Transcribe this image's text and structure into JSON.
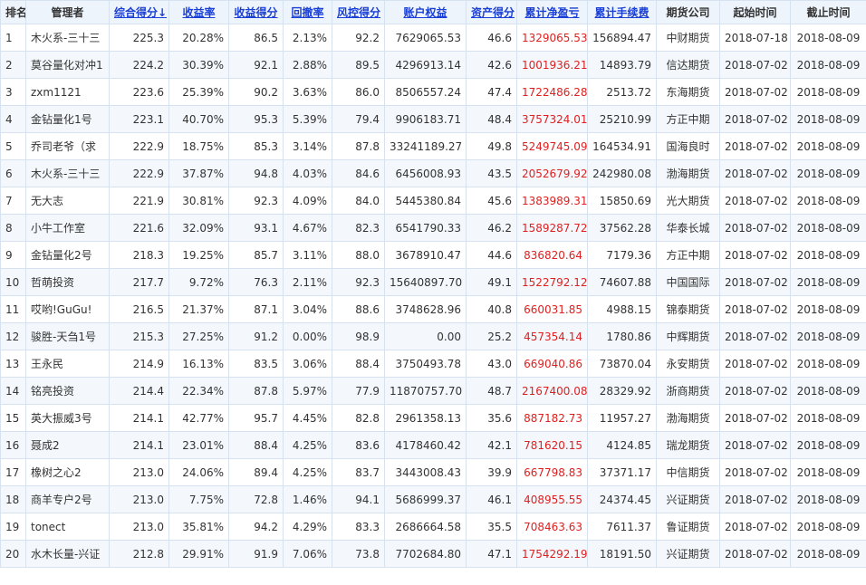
{
  "table": {
    "columns": [
      {
        "key": "rank",
        "label": "排名",
        "sortable": false
      },
      {
        "key": "manager",
        "label": "管理者",
        "sortable": false
      },
      {
        "key": "score",
        "label": "综合得分",
        "sortable": true,
        "arrow": "↓"
      },
      {
        "key": "return_rate",
        "label": "收益率",
        "sortable": true
      },
      {
        "key": "return_score",
        "label": "收益得分",
        "sortable": true
      },
      {
        "key": "drawdown",
        "label": "回撤率",
        "sortable": true
      },
      {
        "key": "risk_score",
        "label": "风控得分",
        "sortable": true
      },
      {
        "key": "equity",
        "label": "账户权益",
        "sortable": true
      },
      {
        "key": "asset_score",
        "label": "资产得分",
        "sortable": true
      },
      {
        "key": "net_pnl",
        "label": "累计净盈亏",
        "sortable": true
      },
      {
        "key": "fees",
        "label": "累计手续费",
        "sortable": true
      },
      {
        "key": "broker",
        "label": "期货公司",
        "sortable": false
      },
      {
        "key": "start",
        "label": "起始时间",
        "sortable": false
      },
      {
        "key": "end",
        "label": "截止时间",
        "sortable": false
      }
    ],
    "rows": [
      [
        "1",
        "木火系-三十三",
        "225.3",
        "20.28%",
        "86.5",
        "2.13%",
        "92.2",
        "7629065.53",
        "46.6",
        "1329065.53",
        "156894.47",
        "中财期货",
        "2018-07-18",
        "2018-08-09"
      ],
      [
        "2",
        "莫谷量化对冲1",
        "224.2",
        "30.39%",
        "92.1",
        "2.88%",
        "89.5",
        "4296913.14",
        "42.6",
        "1001936.21",
        "14893.79",
        "信达期货",
        "2018-07-02",
        "2018-08-09"
      ],
      [
        "3",
        "zxm1121",
        "223.6",
        "25.39%",
        "90.2",
        "3.63%",
        "86.0",
        "8506557.24",
        "47.4",
        "1722486.28",
        "2513.72",
        "东海期货",
        "2018-07-02",
        "2018-08-09"
      ],
      [
        "4",
        "金钻量化1号",
        "223.1",
        "40.70%",
        "95.3",
        "5.39%",
        "79.4",
        "9906183.71",
        "48.4",
        "3757324.01",
        "25210.99",
        "方正中期",
        "2018-07-02",
        "2018-08-09"
      ],
      [
        "5",
        "乔司老爷（求",
        "222.9",
        "18.75%",
        "85.3",
        "3.14%",
        "87.8",
        "33241189.27",
        "49.8",
        "5249745.09",
        "164534.91",
        "国海良时",
        "2018-07-02",
        "2018-08-09"
      ],
      [
        "6",
        "木火系-三十三",
        "222.9",
        "37.87%",
        "94.8",
        "4.03%",
        "84.6",
        "6456008.93",
        "43.5",
        "2052679.92",
        "242980.08",
        "渤海期货",
        "2018-07-02",
        "2018-08-09"
      ],
      [
        "7",
        "无大志",
        "221.9",
        "30.81%",
        "92.3",
        "4.09%",
        "84.0",
        "5445380.84",
        "45.6",
        "1383989.31",
        "15850.69",
        "光大期货",
        "2018-07-02",
        "2018-08-09"
      ],
      [
        "8",
        "小牛工作室",
        "221.6",
        "32.09%",
        "93.1",
        "4.67%",
        "82.3",
        "6541790.33",
        "46.2",
        "1589287.72",
        "37562.28",
        "华泰长城",
        "2018-07-02",
        "2018-08-09"
      ],
      [
        "9",
        "金钻量化2号",
        "218.3",
        "19.25%",
        "85.7",
        "3.11%",
        "88.0",
        "3678910.47",
        "44.6",
        "836820.64",
        "7179.36",
        "方正中期",
        "2018-07-02",
        "2018-08-09"
      ],
      [
        "10",
        "哲萌投资",
        "217.7",
        "9.72%",
        "76.3",
        "2.11%",
        "92.3",
        "15640897.70",
        "49.1",
        "1522792.12",
        "74607.88",
        "中国国际",
        "2018-07-02",
        "2018-08-09"
      ],
      [
        "11",
        "哎哟!GuGu!",
        "216.5",
        "21.37%",
        "87.1",
        "3.04%",
        "88.6",
        "3748628.96",
        "40.8",
        "660031.85",
        "4988.15",
        "锦泰期货",
        "2018-07-02",
        "2018-08-09"
      ],
      [
        "12",
        "骏胜-天刍1号",
        "215.3",
        "27.25%",
        "91.2",
        "0.00%",
        "98.9",
        "0.00",
        "25.2",
        "457354.14",
        "1780.86",
        "中辉期货",
        "2018-07-02",
        "2018-08-09"
      ],
      [
        "13",
        "王永民",
        "214.9",
        "16.13%",
        "83.5",
        "3.06%",
        "88.4",
        "3750493.78",
        "43.0",
        "669040.86",
        "73870.04",
        "永安期货",
        "2018-07-02",
        "2018-08-09"
      ],
      [
        "14",
        "铭亮投资",
        "214.4",
        "22.34%",
        "87.8",
        "5.97%",
        "77.9",
        "11870757.70",
        "48.7",
        "2167400.08",
        "28329.92",
        "浙商期货",
        "2018-07-02",
        "2018-08-09"
      ],
      [
        "15",
        "英大振威3号",
        "214.1",
        "42.77%",
        "95.7",
        "4.45%",
        "82.8",
        "2961358.13",
        "35.6",
        "887182.73",
        "11957.27",
        "渤海期货",
        "2018-07-02",
        "2018-08-09"
      ],
      [
        "16",
        "聂成2",
        "214.1",
        "23.01%",
        "88.4",
        "4.25%",
        "83.6",
        "4178460.42",
        "42.1",
        "781620.15",
        "4124.85",
        "瑞龙期货",
        "2018-07-02",
        "2018-08-09"
      ],
      [
        "17",
        "橡树之心2",
        "213.0",
        "24.06%",
        "89.4",
        "4.25%",
        "83.7",
        "3443008.43",
        "39.9",
        "667798.83",
        "37371.17",
        "中信期货",
        "2018-07-02",
        "2018-08-09"
      ],
      [
        "18",
        "商羊专户2号",
        "213.0",
        "7.75%",
        "72.8",
        "1.46%",
        "94.1",
        "5686999.37",
        "46.1",
        "408955.55",
        "24374.45",
        "兴证期货",
        "2018-07-02",
        "2018-08-09"
      ],
      [
        "19",
        "tonect",
        "213.0",
        "35.81%",
        "94.2",
        "4.29%",
        "83.3",
        "2686664.58",
        "35.5",
        "708463.63",
        "7611.37",
        "鲁证期货",
        "2018-07-02",
        "2018-08-09"
      ],
      [
        "20",
        "水木长量-兴证",
        "212.8",
        "29.91%",
        "91.9",
        "7.06%",
        "73.8",
        "7702684.80",
        "47.1",
        "1754292.19",
        "18191.50",
        "兴证期货",
        "2018-07-02",
        "2018-08-09"
      ]
    ]
  },
  "colors": {
    "link": "#1a3fd6",
    "sort_arrow": "#e02020",
    "pnl": "#e02020",
    "border": "#d6e2ef",
    "header_bg": "#eef4fb"
  }
}
